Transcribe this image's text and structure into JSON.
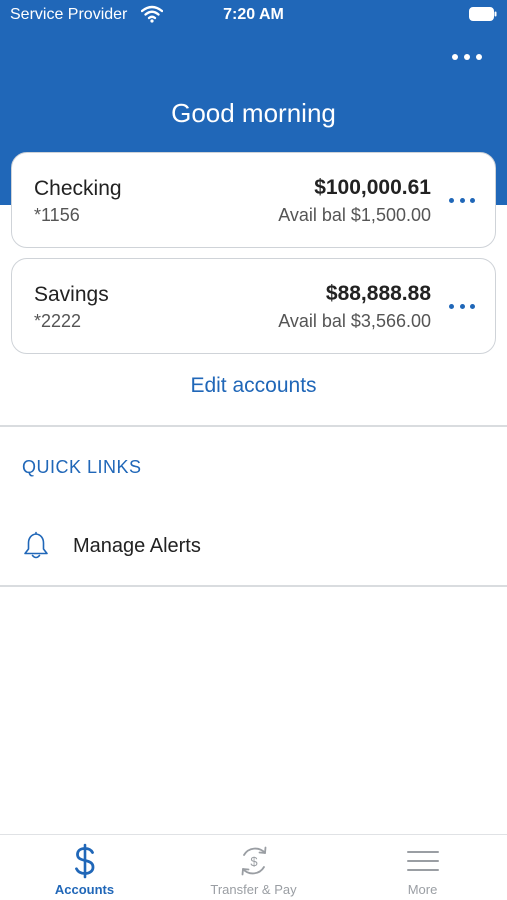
{
  "status_bar": {
    "carrier": "Service Provider",
    "time": "7:20 AM"
  },
  "header": {
    "greeting": "Good morning"
  },
  "accounts": [
    {
      "name": "Checking",
      "number": "*1156",
      "balance": "$100,000.61",
      "available": "Avail bal $1,500.00"
    },
    {
      "name": "Savings",
      "number": "*2222",
      "balance": "$88,888.88",
      "available": "Avail bal $3,566.00"
    }
  ],
  "edit_accounts_label": "Edit accounts",
  "quick_links": {
    "title": "QUICK LINKS",
    "items": [
      {
        "label": "Manage Alerts",
        "icon": "bell-icon"
      }
    ]
  },
  "tabbar": {
    "tabs": [
      {
        "label": "Accounts",
        "icon": "dollar-icon",
        "active": true
      },
      {
        "label": "Transfer & Pay",
        "icon": "transfer-icon",
        "active": false
      },
      {
        "label": "More",
        "icon": "menu-icon",
        "active": false
      }
    ]
  },
  "colors": {
    "brand_blue": "#2067b8",
    "inactive_gray": "#9a9ea3"
  }
}
